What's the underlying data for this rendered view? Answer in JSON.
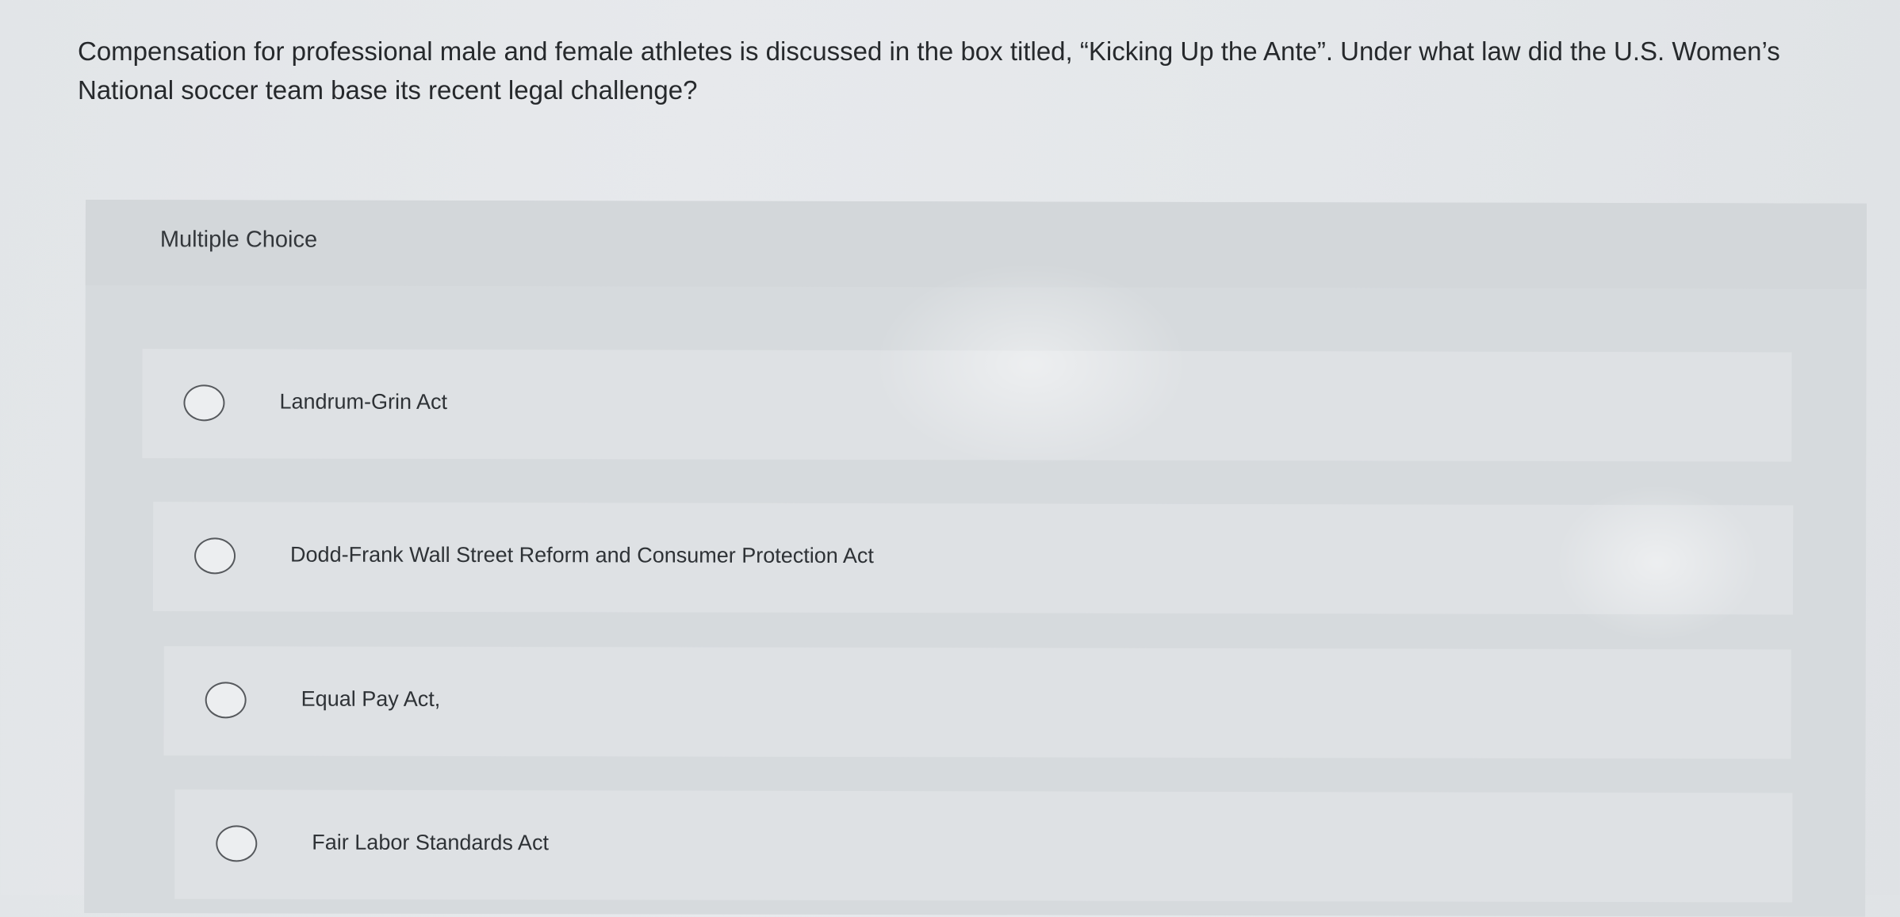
{
  "question": {
    "line1": "Compensation for professional male and female athletes is discussed in the box titled, “Kicking Up the Ante”. Under what law did the U.S. Women’s",
    "line2": "National soccer team base its recent legal challenge?"
  },
  "multiple_choice": {
    "title": "Multiple Choice",
    "options": [
      {
        "label": "Landrum-Grin Act",
        "selected": false
      },
      {
        "label": "Dodd-Frank Wall Street Reform and Consumer Protection Act",
        "selected": false
      },
      {
        "label": "Equal Pay Act,",
        "selected": false
      },
      {
        "label": "Fair Labor Standards Act",
        "selected": false
      }
    ]
  },
  "icons": {
    "radio": "radio-unchecked-icon"
  }
}
